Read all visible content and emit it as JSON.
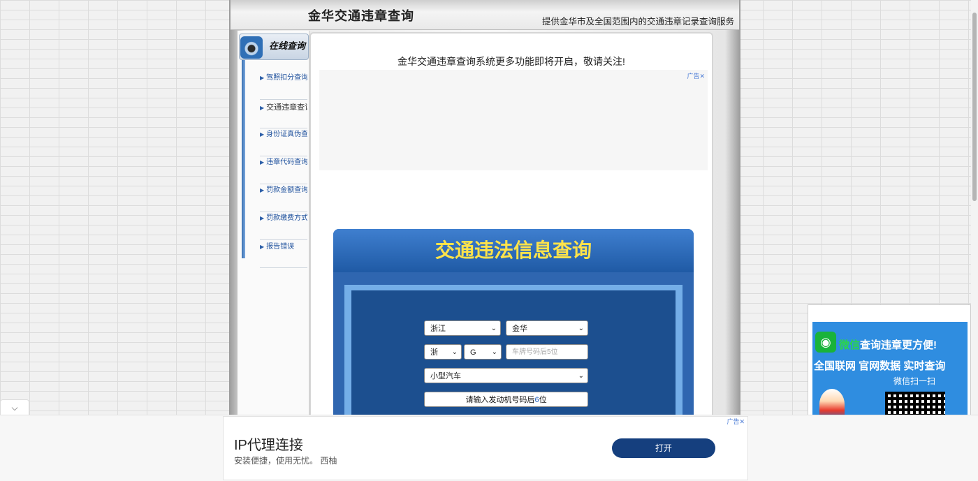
{
  "header": {
    "title": "金华交通违章查询",
    "subtitle": "提供金华市及全国范围内的交通违章记录查询服务"
  },
  "sidebar": {
    "badge_label": "在线查询",
    "items": [
      {
        "label": "驾照扣分查询"
      },
      {
        "label": "交通违章查询"
      },
      {
        "label": "身份证真伪查询"
      },
      {
        "label": "违章代码查询"
      },
      {
        "label": "罚款金额查询"
      },
      {
        "label": "罚款缴费方式"
      },
      {
        "label": "报告错误"
      }
    ]
  },
  "main": {
    "notice": "金华交通违章查询系统更多功能即将开启，敬请关注!",
    "ad_tag": "广告",
    "ad_close": "✕"
  },
  "query": {
    "title": "交通违法信息查询",
    "province": "浙江",
    "city": "金华",
    "plate_prefix": "浙",
    "plate_letter": "G",
    "plate_placeholder": "车牌号码后5位",
    "vehicle_type": "小型汽车",
    "engine_prefix": "请输入发动机号码后",
    "engine_digits": "6",
    "engine_suffix": "位"
  },
  "right_ad": {
    "line1_green": "微信",
    "line1_rest": "查询违章更方便!",
    "line2": "全国联网 官网数据 实时查询",
    "line3": "微信扫一扫"
  },
  "bottom_ad": {
    "title": "IP代理连接",
    "desc": "安装便捷，使用无忧。 西柚",
    "button": "打开",
    "tag": "广告"
  },
  "ui": {
    "collapse_icon": "⌵",
    "chevron": "⌄",
    "arrow": "▶"
  }
}
